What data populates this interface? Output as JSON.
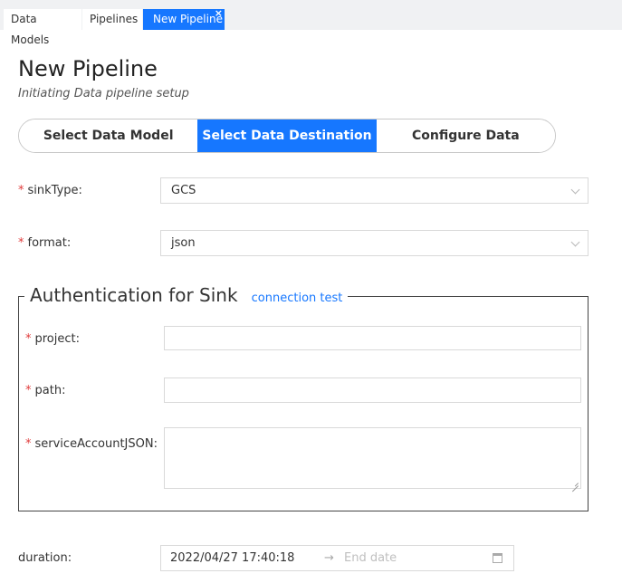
{
  "tabs": [
    {
      "label": "Data Models"
    },
    {
      "label": "Pipelines"
    },
    {
      "label": "New Pipeline",
      "close": "×"
    }
  ],
  "page": {
    "title": "New Pipeline",
    "subtitle": "Initiating Data pipeline setup"
  },
  "steps": [
    {
      "label": "Select Data Model"
    },
    {
      "label": "Select Data Destination",
      "active": true
    },
    {
      "label": "Configure Data"
    }
  ],
  "form": {
    "required_mark": "*",
    "sinkType": {
      "label": "sinkType",
      "value": "GCS"
    },
    "format": {
      "label": "format",
      "value": "json"
    }
  },
  "auth": {
    "title": "Authentication for Sink",
    "link": "connection test",
    "project": {
      "label": "project",
      "value": ""
    },
    "path": {
      "label": "path",
      "value": ""
    },
    "serviceAccountJSON": {
      "label": "serviceAccountJSON",
      "value": ""
    }
  },
  "duration": {
    "label": "duration",
    "start": "2022/04/27 17:40:18",
    "arrow": "→",
    "end_placeholder": "End date"
  },
  "colors": {
    "accent": "#1677ff",
    "required": "#e03b3b"
  }
}
